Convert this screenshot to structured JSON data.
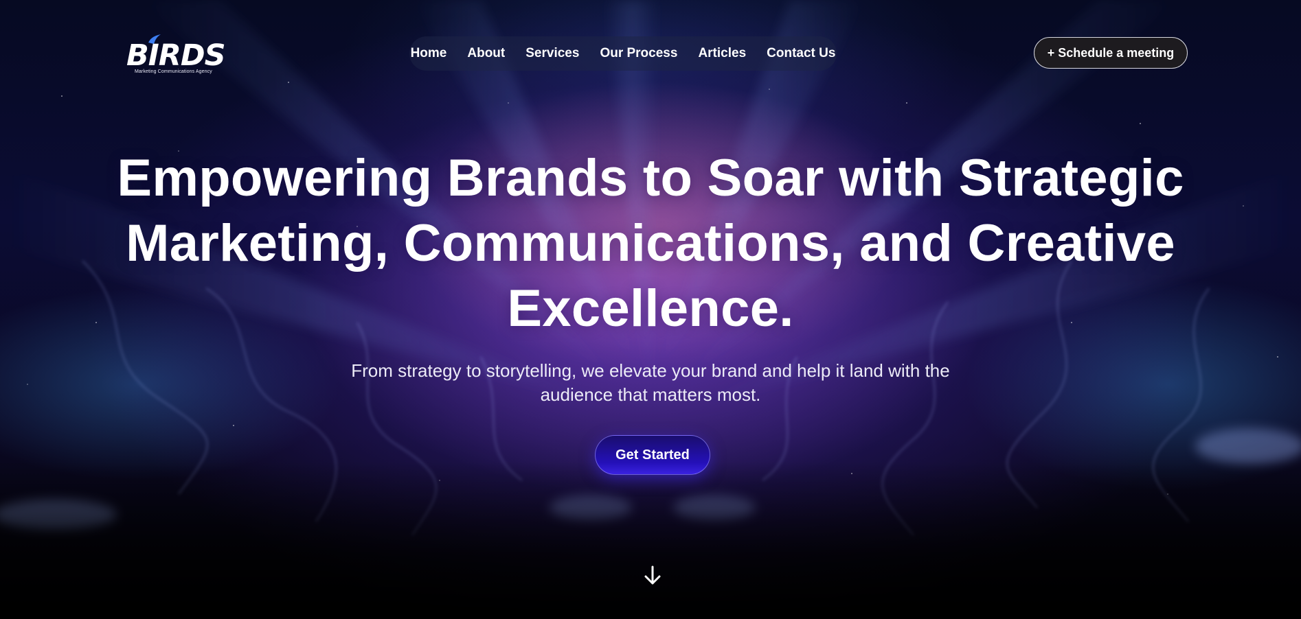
{
  "brand": {
    "logo_text": "BIRDS",
    "tagline": "Marketing Communications Agency"
  },
  "nav": {
    "items": [
      {
        "label": "Home"
      },
      {
        "label": "About"
      },
      {
        "label": "Services"
      },
      {
        "label": "Our Process"
      },
      {
        "label": "Articles"
      },
      {
        "label": "Contact Us"
      }
    ]
  },
  "header": {
    "cta_label": "+ Schedule a meeting"
  },
  "hero": {
    "title": "Empowering Brands to Soar with Strategic Marketing, Communications, and Creative Excellence.",
    "subtitle": "From strategy to storytelling, we elevate your brand and help it land with the audience that matters most.",
    "button_label": "Get Started",
    "scroll_icon": "arrow-down-icon"
  },
  "colors": {
    "accent": "#2410b8",
    "background": "#060a22",
    "nav_background": "#1e2446",
    "meeting_button": "#1d1b1f"
  }
}
